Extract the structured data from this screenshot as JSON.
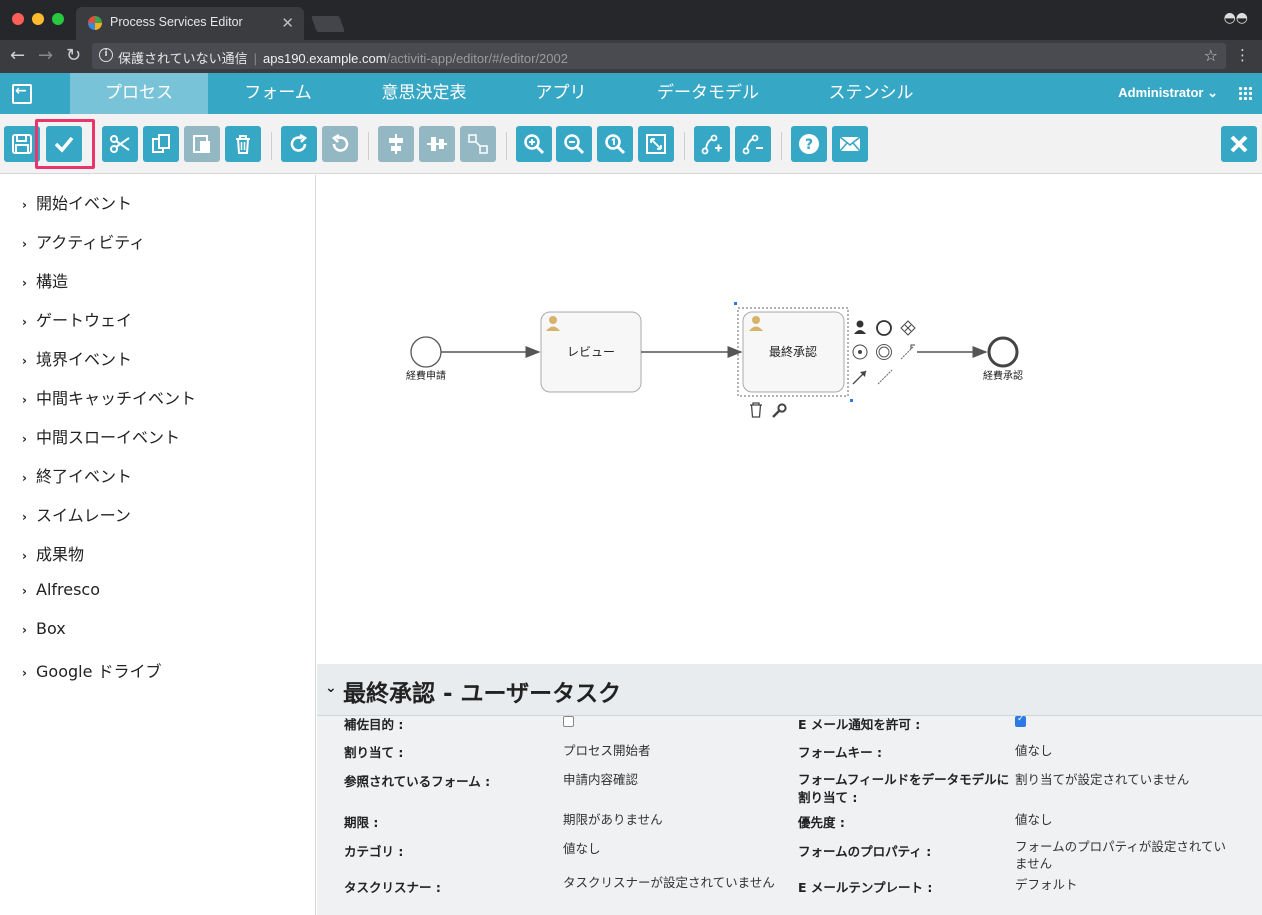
{
  "browser": {
    "tab_title": "Process Services Editor",
    "security_label": "保護されていない通信",
    "url_host": "aps190.example.com",
    "url_path": "/activiti-app/editor/#/editor/2002"
  },
  "app": {
    "nav_tabs": [
      "プロセス",
      "フォーム",
      "意思決定表",
      "アプリ",
      "データモデル",
      "ステンシル"
    ],
    "user_menu": "Administrator"
  },
  "palette": {
    "items": [
      "開始イベント",
      "アクティビティ",
      "構造",
      "ゲートウェイ",
      "境界イベント",
      "中間キャッチイベント",
      "中間スローイベント",
      "終了イベント",
      "スイムレーン",
      "成果物",
      "Alfresco",
      "Box",
      "Google ドライブ"
    ]
  },
  "diagram": {
    "start_event_label": "経費申請",
    "task1_label": "レビュー",
    "task2_label": "最終承認",
    "end_event_label": "経費承認"
  },
  "properties": {
    "title": "最終承認 - ユーザータスク",
    "left": [
      {
        "label": "補佐目的 :",
        "value": ""
      },
      {
        "label": "割り当て :",
        "value": "プロセス開始者"
      },
      {
        "label": "参照されているフォーム :",
        "value": "申請内容確認"
      },
      {
        "label": "期限 :",
        "value": "期限がありません"
      },
      {
        "label": "カテゴリ :",
        "value": "値なし"
      },
      {
        "label": "タスクリスナー :",
        "value": "タスクリスナーが設定されていません"
      }
    ],
    "right": [
      {
        "label": "E メール通知を許可 :",
        "value": ""
      },
      {
        "label": "フォームキー :",
        "value": "値なし"
      },
      {
        "label": "フォームフィールドをデータモデルに割り当て :",
        "value": "割り当てが設定されていません"
      },
      {
        "label": "優先度 :",
        "value": "値なし"
      },
      {
        "label": "フォームのプロパティ :",
        "value": "フォームのプロパティが設定されていません"
      },
      {
        "label": "E メールテンプレート :",
        "value": "デフォルト"
      }
    ],
    "checkbox_left_checked": false,
    "checkbox_right_checked": true
  },
  "colors": {
    "accent": "#37a7c6",
    "highlight": "#e9346e"
  }
}
